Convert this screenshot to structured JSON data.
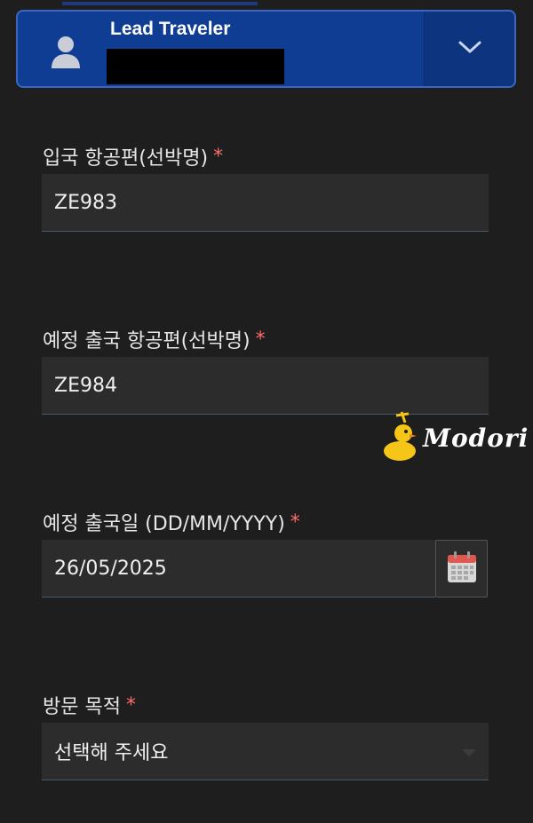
{
  "traveler": {
    "title": "Lead Traveler"
  },
  "fields": {
    "arrival_flight": {
      "label": "입국 항공편(선박명)",
      "required_mark": "*",
      "value": "ZE983"
    },
    "departure_flight": {
      "label": "예정 출국 항공편(선박명)",
      "required_mark": "*",
      "value": "ZE984"
    },
    "departure_date": {
      "label": "예정 출국일 (DD/MM/YYYY)",
      "required_mark": "*",
      "value": "26/05/2025"
    },
    "visit_purpose": {
      "label": "방문 목적",
      "required_mark": "*",
      "value": "선택해 주세요"
    }
  },
  "watermark": {
    "text": "Modori"
  },
  "colors": {
    "card_bg": "#0f3d93",
    "page_bg": "#1e1e1e",
    "field_bg": "#2c2c2c",
    "required": "#ff6b6b"
  },
  "icons": {
    "avatar": "user-icon",
    "toggle": "chevron-down-icon",
    "calendar": "calendar-icon"
  }
}
